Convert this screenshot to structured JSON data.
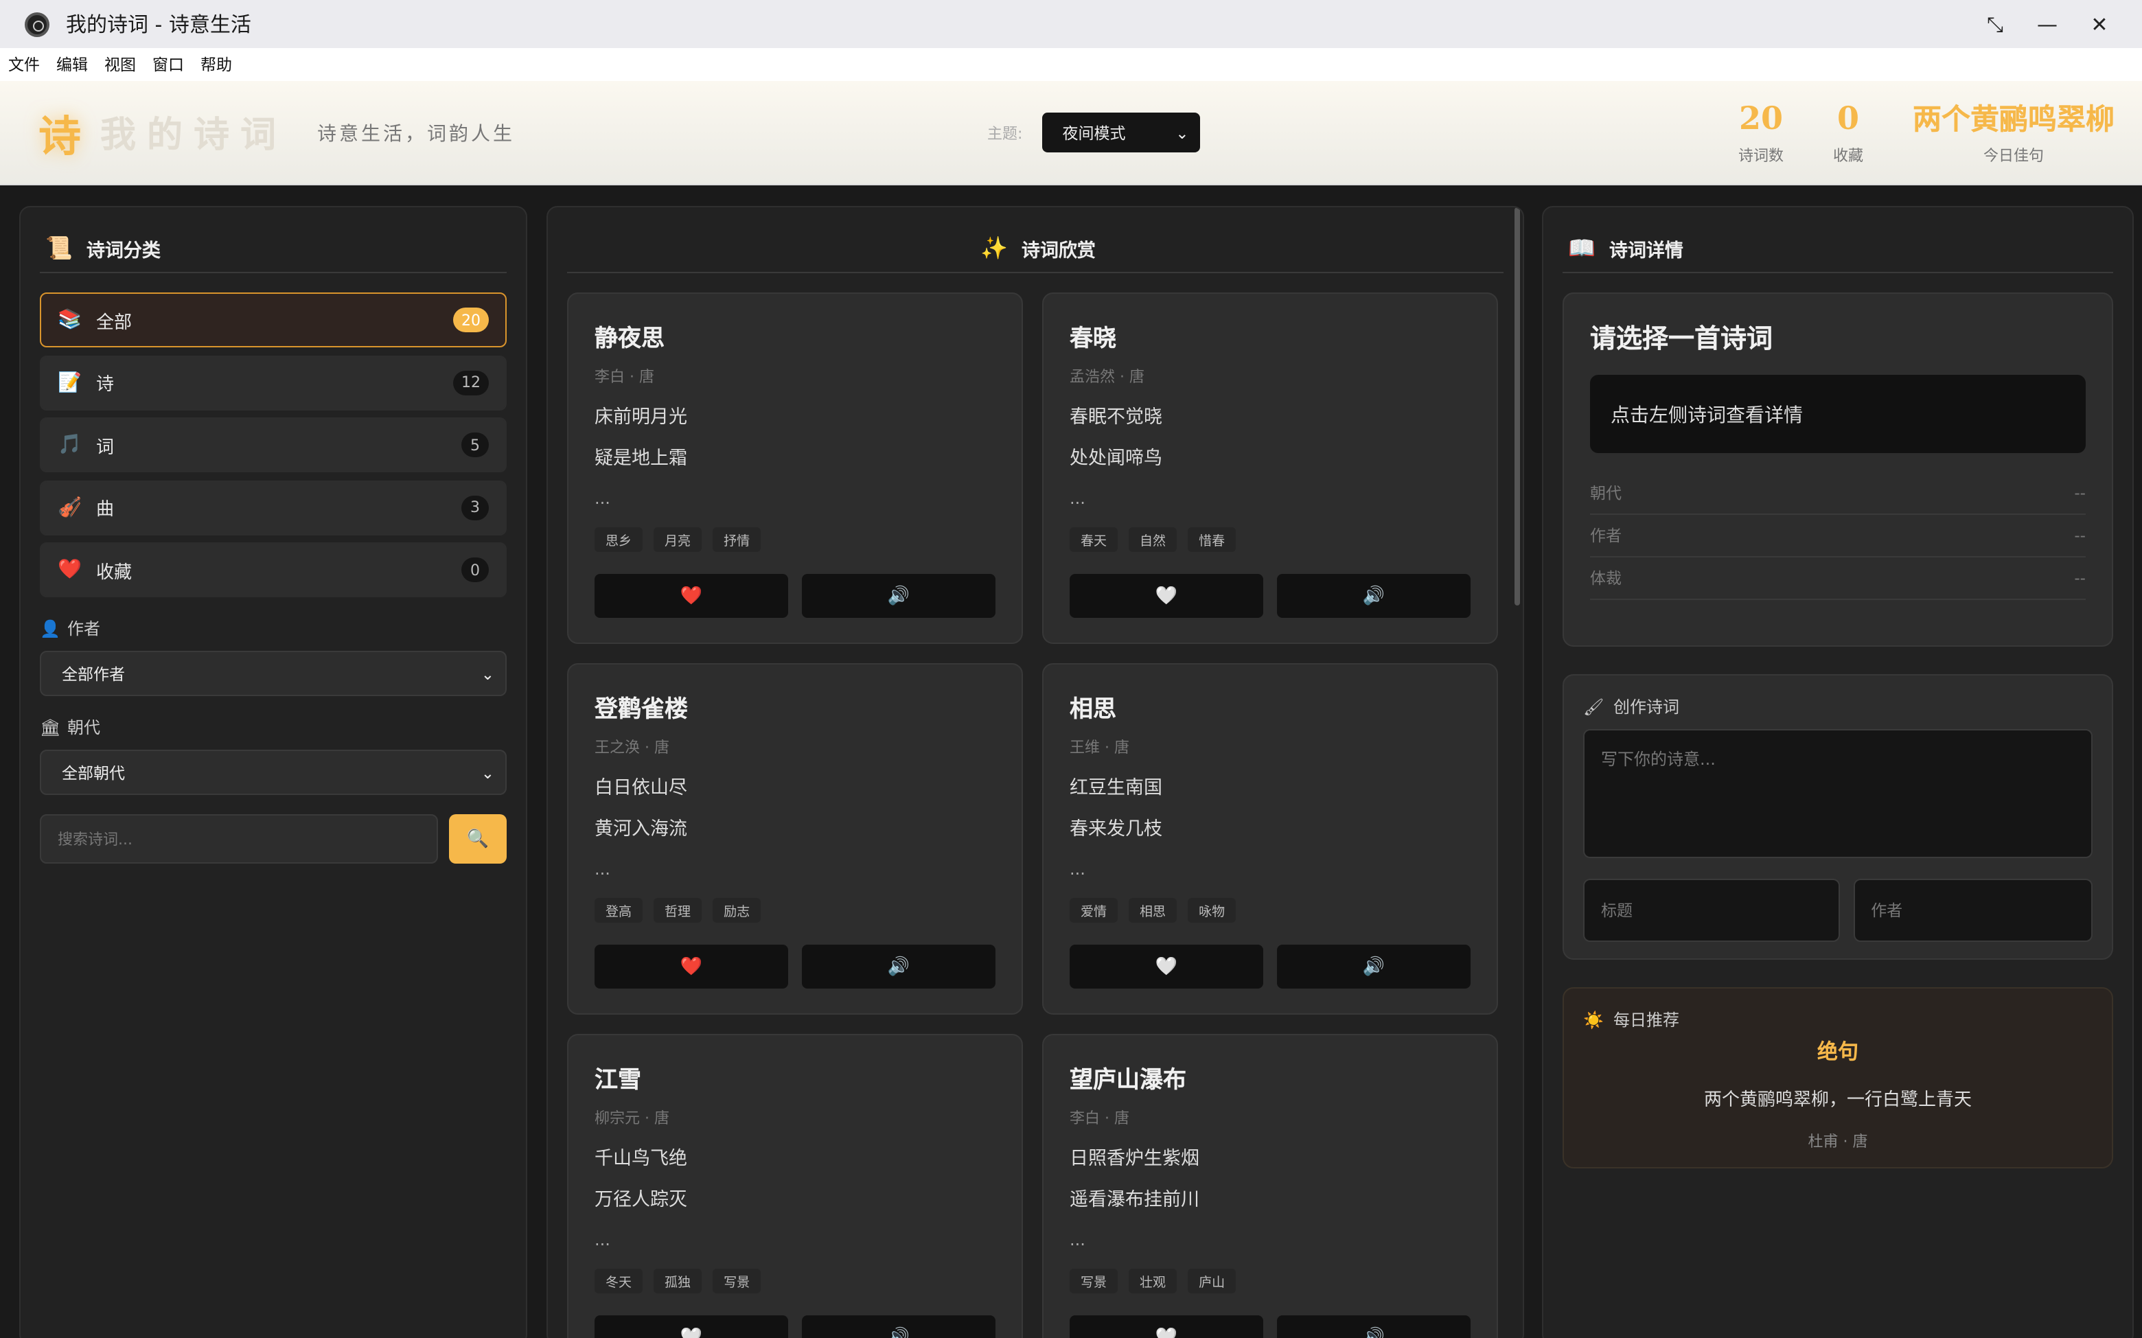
{
  "window": {
    "title": "我的诗词 - 诗意生活"
  },
  "menu": [
    "文件",
    "编辑",
    "视图",
    "窗口",
    "帮助"
  ],
  "header": {
    "brand_mark": "诗",
    "brand_name": "我的诗词",
    "tagline": "诗意生活，词韵人生",
    "theme_label": "主题:",
    "theme_value": "夜间模式",
    "stats": {
      "poem_count": "20",
      "poem_count_label": "诗词数",
      "favorites": "0",
      "favorites_label": "收藏",
      "quote": "两个黄鹂鸣翠柳",
      "quote_label": "今日佳句"
    },
    "accent_color": "#f6b84a"
  },
  "left": {
    "title": "诗词分类",
    "categories": [
      {
        "label": "全部",
        "count": "20",
        "icon": "books-icon"
      },
      {
        "label": "诗",
        "count": "12",
        "icon": "memo-icon"
      },
      {
        "label": "词",
        "count": "5",
        "icon": "music-note-icon"
      },
      {
        "label": "曲",
        "count": "3",
        "icon": "guitar-icon"
      },
      {
        "label": "收藏",
        "count": "0",
        "icon": "heart-icon"
      }
    ],
    "author_label": "作者",
    "author_value": "全部作者",
    "dynasty_label": "朝代",
    "dynasty_value": "全部朝代",
    "search_placeholder": "搜索诗词..."
  },
  "middle": {
    "title": "诗词欣赏",
    "poems": [
      {
        "title": "静夜思",
        "meta": "李白 · 唐",
        "line1": "床前明月光",
        "line2": "疑是地上霜",
        "ellipsis": "...",
        "tags": [
          "思乡",
          "月亮",
          "抒情"
        ],
        "fav": "❤️"
      },
      {
        "title": "春晓",
        "meta": "孟浩然 · 唐",
        "line1": "春眠不觉晓",
        "line2": "处处闻啼鸟",
        "ellipsis": "...",
        "tags": [
          "春天",
          "自然",
          "惜春"
        ],
        "fav": "🤍"
      },
      {
        "title": "登鹳雀楼",
        "meta": "王之涣 · 唐",
        "line1": "白日依山尽",
        "line2": "黄河入海流",
        "ellipsis": "...",
        "tags": [
          "登高",
          "哲理",
          "励志"
        ],
        "fav": "❤️"
      },
      {
        "title": "相思",
        "meta": "王维 · 唐",
        "line1": "红豆生南国",
        "line2": "春来发几枝",
        "ellipsis": "...",
        "tags": [
          "爱情",
          "相思",
          "咏物"
        ],
        "fav": "🤍"
      },
      {
        "title": "江雪",
        "meta": "柳宗元 · 唐",
        "line1": "千山鸟飞绝",
        "line2": "万径人踪灭",
        "ellipsis": "...",
        "tags": [
          "冬天",
          "孤独",
          "写景"
        ],
        "fav": "🤍"
      },
      {
        "title": "望庐山瀑布",
        "meta": "李白 · 唐",
        "line1": "日照香炉生紫烟",
        "line2": "遥看瀑布挂前川",
        "ellipsis": "...",
        "tags": [
          "写景",
          "壮观",
          "庐山"
        ],
        "fav": "🤍"
      }
    ]
  },
  "right": {
    "title": "诗词详情",
    "detail_title": "请选择一首诗词",
    "detail_hint": "点击左侧诗词查看详情",
    "rows": [
      {
        "label": "朝代",
        "value": "--"
      },
      {
        "label": "作者",
        "value": "--"
      },
      {
        "label": "体裁",
        "value": "--"
      }
    ],
    "compose_title": "创作诗词",
    "compose_placeholder": "写下你的诗意...",
    "title_placeholder": "标题",
    "author_placeholder": "作者",
    "daily_head": "每日推荐",
    "daily_title": "绝句",
    "daily_line": "两个黄鹂鸣翠柳，一行白鹭上青天",
    "daily_meta": "杜甫 · 唐"
  }
}
